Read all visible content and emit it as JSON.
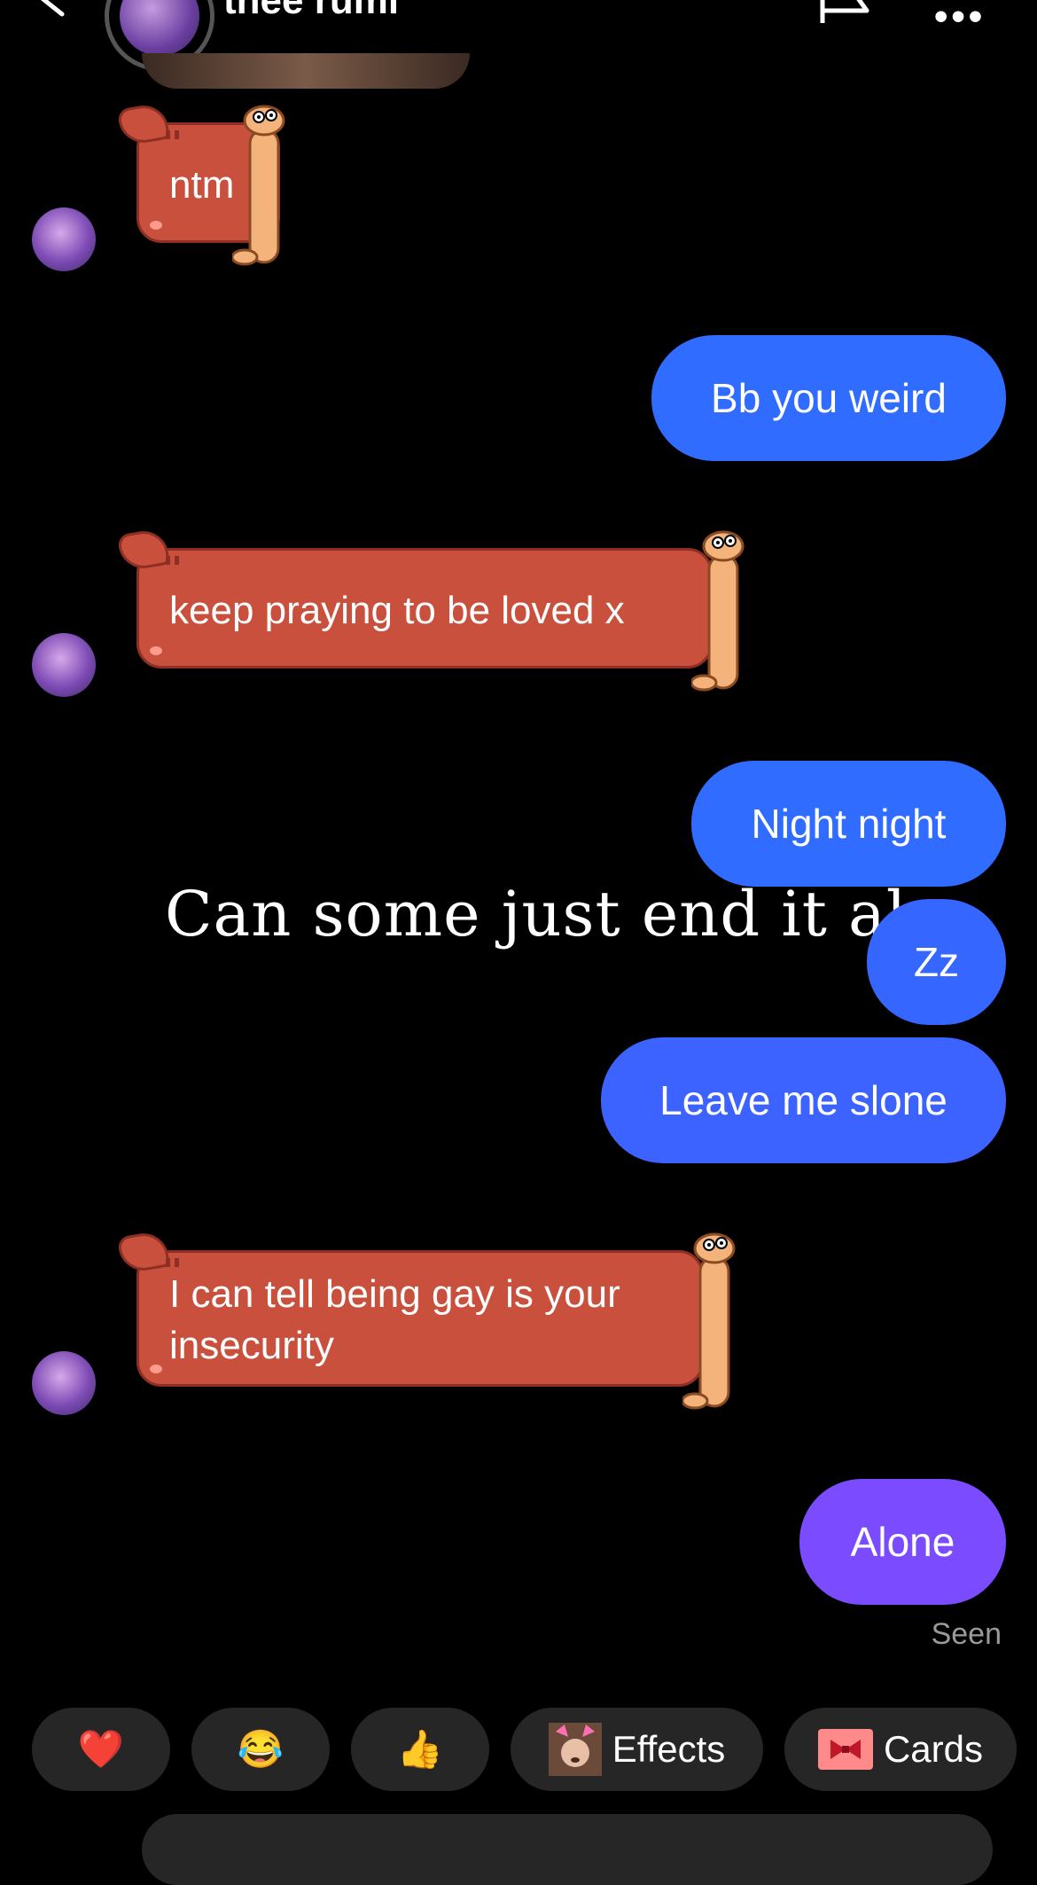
{
  "header": {
    "username": "thee rumi",
    "back_icon": "chevron-left-icon",
    "flag_icon": "flag-icon",
    "more_icon": "more-icon"
  },
  "messages": [
    {
      "side": "received",
      "text": "ntm"
    },
    {
      "side": "sent",
      "text": "Bb you weird"
    },
    {
      "side": "received",
      "text": "keep praying to be loved x"
    },
    {
      "side": "sent",
      "text": "Night night"
    },
    {
      "side": "sent",
      "text": "Zz"
    },
    {
      "side": "sent",
      "text": "Leave me slone"
    },
    {
      "side": "received",
      "text_line1": "I can tell being gay is your",
      "text_line2": "insecurity"
    },
    {
      "side": "sent",
      "text": "Alone"
    }
  ],
  "overlay_caption": "Can some just end it alr",
  "status": {
    "seen": "Seen"
  },
  "colors": {
    "sent_blue": "#2f6cff",
    "sent_blue_mid": "#3c62ff",
    "sent_purple": "#7b4cff",
    "received_red": "#c9503d"
  },
  "reactions": {
    "heart": "❤️",
    "laugh": "😂",
    "thumbs_up": "👍",
    "effects_label": "Effects",
    "cards_label": "Cards"
  }
}
